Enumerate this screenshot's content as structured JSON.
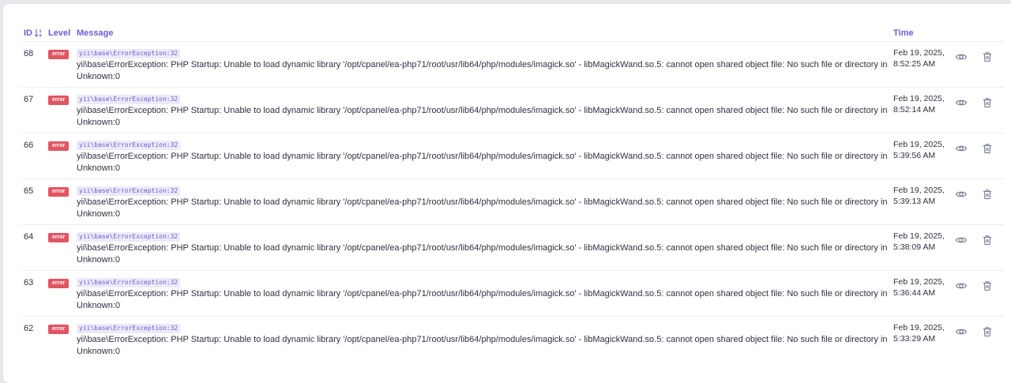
{
  "header": {
    "id": "ID",
    "level": "Level",
    "message": "Message",
    "time": "Time"
  },
  "icons": {
    "sort": "sort-numeric-desc-icon",
    "view": "eye-icon",
    "delete": "trash-icon"
  },
  "colors": {
    "accent": "#6d5dd3",
    "error_badge": "#e25563",
    "code_bg": "#eceaf9",
    "icon": "#7c849a"
  },
  "rows": [
    {
      "id": "68",
      "level": "error",
      "category": "yii\\base\\ErrorException:32",
      "message": "yii\\base\\ErrorException: PHP Startup: Unable to load dynamic library '/opt/cpanel/ea-php71/root/usr/lib64/php/modules/imagick.so' - libMagickWand.so.5: cannot open shared object file: No such file or directory in Unknown:0",
      "time_date": "Feb 19, 2025,",
      "time_clock": "8:52:25 AM"
    },
    {
      "id": "67",
      "level": "error",
      "category": "yii\\base\\ErrorException:32",
      "message": "yii\\base\\ErrorException: PHP Startup: Unable to load dynamic library '/opt/cpanel/ea-php71/root/usr/lib64/php/modules/imagick.so' - libMagickWand.so.5: cannot open shared object file: No such file or directory in Unknown:0",
      "time_date": "Feb 19, 2025,",
      "time_clock": "8:52:14 AM"
    },
    {
      "id": "66",
      "level": "error",
      "category": "yii\\base\\ErrorException:32",
      "message": "yii\\base\\ErrorException: PHP Startup: Unable to load dynamic library '/opt/cpanel/ea-php71/root/usr/lib64/php/modules/imagick.so' - libMagickWand.so.5: cannot open shared object file: No such file or directory in Unknown:0",
      "time_date": "Feb 19, 2025,",
      "time_clock": "5:39:56 AM"
    },
    {
      "id": "65",
      "level": "error",
      "category": "yii\\base\\ErrorException:32",
      "message": "yii\\base\\ErrorException: PHP Startup: Unable to load dynamic library '/opt/cpanel/ea-php71/root/usr/lib64/php/modules/imagick.so' - libMagickWand.so.5: cannot open shared object file: No such file or directory in Unknown:0",
      "time_date": "Feb 19, 2025,",
      "time_clock": "5:39:13 AM"
    },
    {
      "id": "64",
      "level": "error",
      "category": "yii\\base\\ErrorException:32",
      "message": "yii\\base\\ErrorException: PHP Startup: Unable to load dynamic library '/opt/cpanel/ea-php71/root/usr/lib64/php/modules/imagick.so' - libMagickWand.so.5: cannot open shared object file: No such file or directory in Unknown:0",
      "time_date": "Feb 19, 2025,",
      "time_clock": "5:38:09 AM"
    },
    {
      "id": "63",
      "level": "error",
      "category": "yii\\base\\ErrorException:32",
      "message": "yii\\base\\ErrorException: PHP Startup: Unable to load dynamic library '/opt/cpanel/ea-php71/root/usr/lib64/php/modules/imagick.so' - libMagickWand.so.5: cannot open shared object file: No such file or directory in Unknown:0",
      "time_date": "Feb 19, 2025,",
      "time_clock": "5:36:44 AM"
    },
    {
      "id": "62",
      "level": "error",
      "category": "yii\\base\\ErrorException:32",
      "message": "yii\\base\\ErrorException: PHP Startup: Unable to load dynamic library '/opt/cpanel/ea-php71/root/usr/lib64/php/modules/imagick.so' - libMagickWand.so.5: cannot open shared object file: No such file or directory in Unknown:0",
      "time_date": "Feb 19, 2025,",
      "time_clock": "5:33:29 AM"
    }
  ]
}
